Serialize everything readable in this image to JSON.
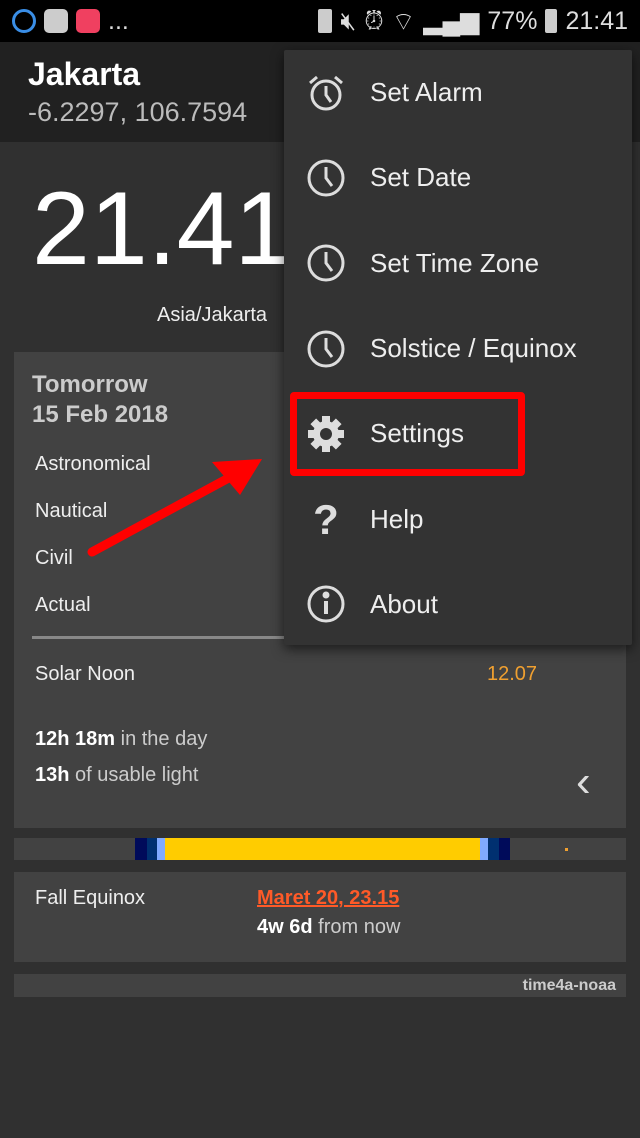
{
  "status_bar": {
    "left_icons": [
      "s-app-icon",
      "inbox-icon",
      "vidmate-icon"
    ],
    "overflow": "...",
    "right_icons": [
      "battery-saver-icon",
      "mute-icon",
      "alarm-icon",
      "wifi-icon",
      "signal-icon"
    ],
    "battery": "77%",
    "time": "21:41"
  },
  "header": {
    "city": "Jakarta",
    "coords": "-6.2297, 106.7594"
  },
  "clock": {
    "time": "21.41",
    "timezone": "Asia/Jakarta"
  },
  "card": {
    "day": "Tomorrow",
    "date": "15 Feb 2018",
    "rows": [
      "Astronomical",
      "Nautical",
      "Civil",
      "Actual"
    ],
    "solar_noon_label": "Solar Noon",
    "solar_noon_value": "12.07",
    "day_length_bold": "12h 18m",
    "day_length_rest": " in the day",
    "usable_bold": "13h",
    "usable_rest": " of usable light",
    "prev_icon": "chevron-left-icon"
  },
  "day_bar": {
    "segments": [
      {
        "c": "#000b5a",
        "from": 0.198,
        "to": 0.217
      },
      {
        "c": "#003070",
        "from": 0.217,
        "to": 0.234
      },
      {
        "c": "#80aaff",
        "from": 0.234,
        "to": 0.247
      },
      {
        "c": "#ffcc00",
        "from": 0.247,
        "to": 0.761
      },
      {
        "c": "#80aaff",
        "from": 0.761,
        "to": 0.774
      },
      {
        "c": "#003070",
        "from": 0.774,
        "to": 0.792
      },
      {
        "c": "#000b5a",
        "from": 0.792,
        "to": 0.81
      }
    ]
  },
  "equinox": {
    "label": "Fall Equinox",
    "date": "Maret 20, 23.15",
    "rel_bold": "4w 6d",
    "rel_rest": " from now"
  },
  "footer": {
    "source": "time4a-noaa"
  },
  "menu": {
    "items": [
      {
        "label": "Set Alarm",
        "icon": "alarm-clock-icon"
      },
      {
        "label": "Set Date",
        "icon": "clock-icon"
      },
      {
        "label": "Set Time Zone",
        "icon": "clock-icon"
      },
      {
        "label": "Solstice / Equinox",
        "icon": "clock-icon"
      },
      {
        "label": "Settings",
        "icon": "gear-icon"
      },
      {
        "label": "Help",
        "icon": "question-icon"
      },
      {
        "label": "About",
        "icon": "info-icon"
      }
    ]
  },
  "colors": {
    "accent_orange": "#f0a030",
    "link": "#ff5a28",
    "highlight": "#ff0000"
  }
}
